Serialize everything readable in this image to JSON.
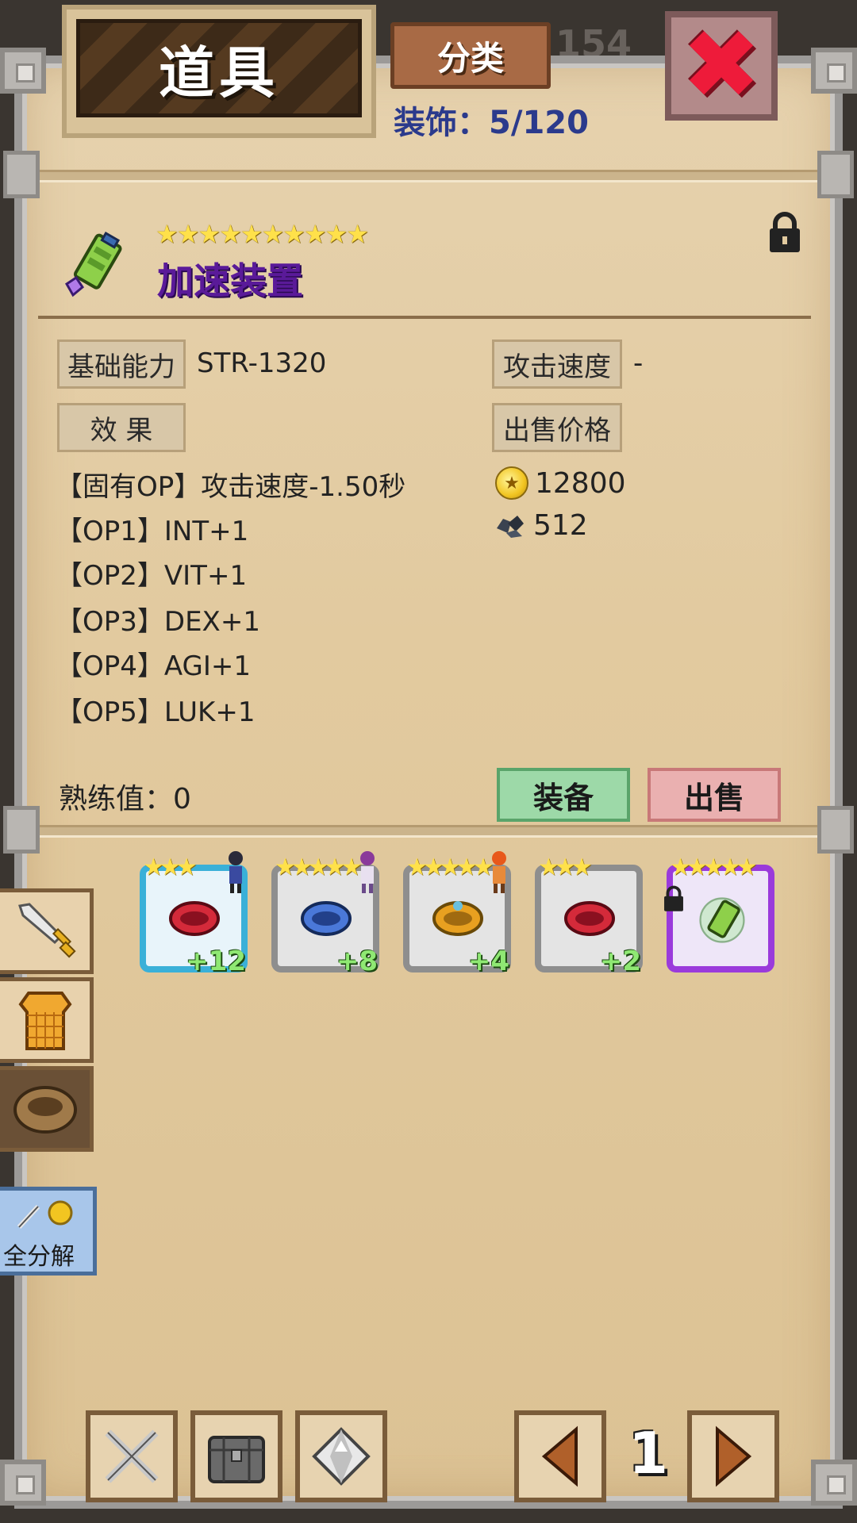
{
  "header": {
    "title": "道具",
    "category_button": "分类",
    "decoration_count": "装饰：5/120",
    "background_number": "154",
    "close_icon": "close-x-icon"
  },
  "item": {
    "stars": "★★★★★★★★★★",
    "star_count": 10,
    "name": "加速装置",
    "name_color": "#5a1a99",
    "icon": "speed-device-icon",
    "locked": true
  },
  "stats": {
    "base_label": "基础能力",
    "base_value": "STR-1320",
    "atk_speed_label": "攻击速度",
    "atk_speed_value": "-",
    "effect_label": "效 果",
    "sell_price_label": "出售价格",
    "options": [
      "【固有OP】攻击速度-1.50秒",
      "【OP1】INT+1",
      "【OP2】VIT+1",
      "【OP3】DEX+1",
      "【OP4】AGI+1",
      "【OP5】LUK+1"
    ],
    "gold_price": "12800",
    "ore_price": "512",
    "mastery": "熟练值：0"
  },
  "actions": {
    "equip": "装备",
    "sell": "出售"
  },
  "inventory": [
    {
      "stars": "★★★",
      "plus": "+12",
      "ring_color": "#d42a3a",
      "frame": "#3ab0d8",
      "has_chibi": true
    },
    {
      "stars": "★★★★★",
      "plus": "+8",
      "ring_color": "#4a78d8",
      "frame": "#8e8e8e",
      "has_chibi": true
    },
    {
      "stars": "★★★★★",
      "plus": "+4",
      "ring_color": "#e8a020",
      "frame": "#8e8e8e",
      "has_chibi": true
    },
    {
      "stars": "★★★",
      "plus": "+2",
      "ring_color": "#d42a3a",
      "frame": "#8e8e8e",
      "has_chibi": false
    },
    {
      "stars": "★★★★★",
      "plus": "",
      "ring_color": "#8ed04a",
      "frame": "#9a3adb",
      "has_chibi": false,
      "locked": true,
      "selected": true
    }
  ],
  "side_tabs": [
    "sword-icon",
    "armor-icon",
    "accessory-icon"
  ],
  "decompose_label": "全分解",
  "bottom": {
    "buttons": [
      "crossed-swords-icon",
      "treasure-chest-icon",
      "diamond-icon"
    ],
    "page": "1"
  },
  "colors": {
    "parchment": "#e2ca9f",
    "equip_button": "#9dd9a8",
    "sell_button": "#eab0b0",
    "star": "#ffe14a"
  }
}
